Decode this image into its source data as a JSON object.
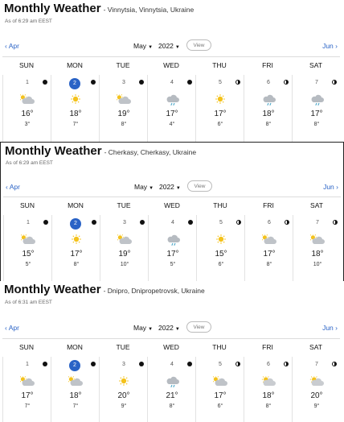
{
  "common": {
    "prev_label": "Apr",
    "next_label": "Jun",
    "month": "May",
    "year": "2022",
    "view_label": "View",
    "weekdays": [
      "SUN",
      "MON",
      "TUE",
      "WED",
      "THU",
      "FRI",
      "SAT"
    ]
  },
  "panels": [
    {
      "title": "Monthly Weather",
      "location": "- Vinnytsia, Vinnytsia, Ukraine",
      "as_of": "As of 6:29 am EEST",
      "days": [
        {
          "date": "1",
          "icon": "partly-cloudy-icon",
          "moon": "full",
          "hi": "16°",
          "lo": "3°"
        },
        {
          "date": "2",
          "icon": "sunny-icon",
          "moon": "full",
          "hi": "18°",
          "lo": "7°",
          "today": true
        },
        {
          "date": "3",
          "icon": "partly-cloudy-icon",
          "moon": "full",
          "hi": "19°",
          "lo": "8°"
        },
        {
          "date": "4",
          "icon": "rain-icon",
          "moon": "full",
          "hi": "17°",
          "lo": "4°"
        },
        {
          "date": "5",
          "icon": "sunny-icon",
          "moon": "half",
          "hi": "17°",
          "lo": "6°"
        },
        {
          "date": "6",
          "icon": "rain-icon",
          "moon": "half",
          "hi": "18°",
          "lo": "8°"
        },
        {
          "date": "7",
          "icon": "rain-icon",
          "moon": "half",
          "hi": "17°",
          "lo": "8°"
        }
      ]
    },
    {
      "title": "Monthly Weather",
      "location": "- Cherkasy, Cherkasy, Ukraine",
      "as_of": "As of 6:29 am EEST",
      "days": [
        {
          "date": "1",
          "icon": "partly-cloudy-icon",
          "moon": "full",
          "hi": "15°",
          "lo": "5°"
        },
        {
          "date": "2",
          "icon": "sunny-icon",
          "moon": "full",
          "hi": "17°",
          "lo": "8°",
          "today": true
        },
        {
          "date": "3",
          "icon": "partly-cloudy-icon",
          "moon": "full",
          "hi": "19°",
          "lo": "10°"
        },
        {
          "date": "4",
          "icon": "rain-icon",
          "moon": "full",
          "hi": "17°",
          "lo": "5°"
        },
        {
          "date": "5",
          "icon": "sunny-icon",
          "moon": "half",
          "hi": "15°",
          "lo": "6°"
        },
        {
          "date": "6",
          "icon": "partly-cloudy-icon",
          "moon": "half",
          "hi": "17°",
          "lo": "8°"
        },
        {
          "date": "7",
          "icon": "partly-cloudy-icon",
          "moon": "half",
          "hi": "18°",
          "lo": "10°"
        }
      ]
    },
    {
      "title": "Monthly Weather",
      "location": "- Dnipro, Dnipropetrovsk, Ukraine",
      "as_of": "As of 6:31 am EEST",
      "days": [
        {
          "date": "1",
          "icon": "partly-cloudy-icon",
          "moon": "full",
          "hi": "17°",
          "lo": "7°"
        },
        {
          "date": "2",
          "icon": "partly-cloudy-icon",
          "moon": "full",
          "hi": "18°",
          "lo": "7°",
          "today": true
        },
        {
          "date": "3",
          "icon": "sunny-icon",
          "moon": "full",
          "hi": "20°",
          "lo": "9°"
        },
        {
          "date": "4",
          "icon": "rain-icon",
          "moon": "full",
          "hi": "21°",
          "lo": "8°"
        },
        {
          "date": "5",
          "icon": "partly-cloudy-icon",
          "moon": "half",
          "hi": "17°",
          "lo": "6°"
        },
        {
          "date": "6",
          "icon": "partly-sunny-icon",
          "moon": "half",
          "hi": "18°",
          "lo": "8°"
        },
        {
          "date": "7",
          "icon": "partly-sunny-icon",
          "moon": "half",
          "hi": "20°",
          "lo": "9°"
        }
      ]
    }
  ]
}
